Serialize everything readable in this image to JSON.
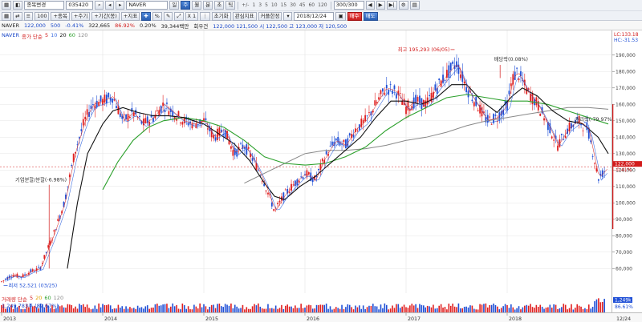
{
  "toolbar": {
    "menu_label": "종목변경",
    "code": "035420",
    "name": "NAVER",
    "period_tabs": [
      "일",
      "주",
      "월",
      "분",
      "초",
      "틱"
    ],
    "active_period": "주",
    "nav_minus": "+/-",
    "nav_numbers": [
      "1",
      "3",
      "5",
      "10",
      "15",
      "30",
      "45",
      "60",
      "120"
    ],
    "count_value": "300",
    "count_total": "/300",
    "row2_items": [
      "종목",
      "주기",
      "기간(봉)",
      "지표"
    ],
    "mult_label": "X 1",
    "init_button": "초기화",
    "interest_button": "관심지표",
    "custom_button": "커플한정",
    "date_value": "2018/12/24",
    "buy_button": "매수",
    "sell_button": "매도"
  },
  "infobar": {
    "name": "NAVER",
    "price": "122,000",
    "change": "500",
    "change_pct": "-0.41%",
    "volume": "322,665",
    "ratio": "86.92%",
    "turnover": "0.20%",
    "amount": "39,344백만",
    "turnover_label": "회우건",
    "ohlc_label": "122,000 121,500 시 122,500 고 123,000 저 120,500"
  },
  "price_legend": {
    "name": "NAVER",
    "label": "종가 단순",
    "periods": [
      "5",
      "10",
      "20",
      "60",
      "120"
    ],
    "colors": [
      "#d21b1b",
      "#3f6fe0",
      "#111111",
      "#2ca02c",
      "#888888"
    ]
  },
  "volume_legend": {
    "label": "거래량 단순",
    "periods": [
      "5",
      "20",
      "60",
      "120"
    ],
    "colors": [
      "#d21b1b",
      "#e0a000",
      "#2ca02c",
      "#888888"
    ],
    "sub": "1,249,783주 (89.67%)"
  },
  "right_panel": {
    "lc": "LC:133.18",
    "hc": "HC:-31.53",
    "last_price_tag": "122,000",
    "last_change_tag": "-0.41%",
    "volume_tag": "1,249k",
    "volume_pct_tag": "86.61%"
  },
  "annotations": {
    "high": "최고 195,293 (06/05)",
    "low": "최저 52,521 (03/25)",
    "split": "기업분할/분할(-6.98%)",
    "dividend": "배당락(0.08%)",
    "right_note": "권리락(-79.97%)"
  },
  "chart_data": {
    "type": "candlestick",
    "frequency": "weekly",
    "y_ticks": [
      60000,
      70000,
      80000,
      90000,
      100000,
      110000,
      120000,
      130000,
      140000,
      150000,
      160000,
      170000,
      180000,
      190000
    ],
    "ylim": [
      45000,
      205000
    ],
    "x_labels": [
      "2013",
      "2014",
      "2015",
      "2016",
      "2017",
      "2018",
      "12/24"
    ],
    "close_path": [
      [
        2013.0,
        52000
      ],
      [
        2013.1,
        56000
      ],
      [
        2013.2,
        55000
      ],
      [
        2013.28,
        58000
      ],
      [
        2013.38,
        60000
      ],
      [
        2013.52,
        82000
      ],
      [
        2013.62,
        100000
      ],
      [
        2013.72,
        130000
      ],
      [
        2013.82,
        150000
      ],
      [
        2013.9,
        160000
      ],
      [
        2014.0,
        162000
      ],
      [
        2014.1,
        165000
      ],
      [
        2014.2,
        150000
      ],
      [
        2014.3,
        155000
      ],
      [
        2014.4,
        148000
      ],
      [
        2014.5,
        152000
      ],
      [
        2014.6,
        160000
      ],
      [
        2014.7,
        155000
      ],
      [
        2014.8,
        150000
      ],
      [
        2014.9,
        148000
      ],
      [
        2015.0,
        150000
      ],
      [
        2015.1,
        140000
      ],
      [
        2015.2,
        145000
      ],
      [
        2015.3,
        130000
      ],
      [
        2015.4,
        135000
      ],
      [
        2015.5,
        125000
      ],
      [
        2015.6,
        112000
      ],
      [
        2015.7,
        95000
      ],
      [
        2015.8,
        105000
      ],
      [
        2015.9,
        112000
      ],
      [
        2016.0,
        118000
      ],
      [
        2016.1,
        114000
      ],
      [
        2016.2,
        128000
      ],
      [
        2016.3,
        138000
      ],
      [
        2016.4,
        135000
      ],
      [
        2016.5,
        145000
      ],
      [
        2016.6,
        150000
      ],
      [
        2016.7,
        160000
      ],
      [
        2016.8,
        170000
      ],
      [
        2016.9,
        168000
      ],
      [
        2017.0,
        158000
      ],
      [
        2017.1,
        162000
      ],
      [
        2017.2,
        160000
      ],
      [
        2017.3,
        170000
      ],
      [
        2017.4,
        178000
      ],
      [
        2017.5,
        185000
      ],
      [
        2017.6,
        170000
      ],
      [
        2017.7,
        160000
      ],
      [
        2017.8,
        150000
      ],
      [
        2017.9,
        152000
      ],
      [
        2018.0,
        160000
      ],
      [
        2018.05,
        175000
      ],
      [
        2018.1,
        180000
      ],
      [
        2018.2,
        168000
      ],
      [
        2018.3,
        160000
      ],
      [
        2018.4,
        148000
      ],
      [
        2018.5,
        135000
      ],
      [
        2018.6,
        145000
      ],
      [
        2018.7,
        150000
      ],
      [
        2018.8,
        145000
      ],
      [
        2018.9,
        115000
      ],
      [
        2019.0,
        122000
      ]
    ],
    "series": [
      {
        "name": "5",
        "color": "#d21b1b"
      },
      {
        "name": "10",
        "color": "#3f6fe0"
      },
      {
        "name": "20",
        "color": "#111111"
      },
      {
        "name": "60",
        "color": "#2ca02c"
      },
      {
        "name": "120",
        "color": "#888888"
      }
    ],
    "ma20": [
      [
        2013.65,
        60000
      ],
      [
        2013.75,
        100000
      ],
      [
        2013.85,
        130000
      ],
      [
        2014.0,
        148000
      ],
      [
        2014.1,
        156000
      ],
      [
        2014.2,
        158000
      ],
      [
        2014.35,
        155000
      ],
      [
        2014.5,
        153000
      ],
      [
        2014.65,
        153000
      ],
      [
        2014.8,
        152000
      ],
      [
        2015.0,
        148000
      ],
      [
        2015.15,
        142000
      ],
      [
        2015.3,
        136000
      ],
      [
        2015.45,
        126000
      ],
      [
        2015.6,
        112000
      ],
      [
        2015.7,
        104000
      ],
      [
        2015.8,
        102000
      ],
      [
        2015.95,
        110000
      ],
      [
        2016.1,
        116000
      ],
      [
        2016.25,
        124000
      ],
      [
        2016.4,
        132000
      ],
      [
        2016.55,
        140000
      ],
      [
        2016.7,
        152000
      ],
      [
        2016.85,
        162000
      ],
      [
        2017.0,
        162000
      ],
      [
        2017.15,
        160000
      ],
      [
        2017.3,
        164000
      ],
      [
        2017.45,
        172000
      ],
      [
        2017.6,
        172000
      ],
      [
        2017.75,
        162000
      ],
      [
        2017.9,
        155000
      ],
      [
        2018.05,
        165000
      ],
      [
        2018.15,
        170000
      ],
      [
        2018.3,
        165000
      ],
      [
        2018.45,
        156000
      ],
      [
        2018.6,
        150000
      ],
      [
        2018.75,
        148000
      ],
      [
        2018.9,
        140000
      ],
      [
        2019.0,
        130000
      ]
    ],
    "ma60": [
      [
        2014.0,
        108000
      ],
      [
        2014.15,
        125000
      ],
      [
        2014.3,
        138000
      ],
      [
        2014.45,
        146000
      ],
      [
        2014.6,
        150000
      ],
      [
        2014.8,
        152000
      ],
      [
        2015.0,
        150000
      ],
      [
        2015.2,
        146000
      ],
      [
        2015.4,
        138000
      ],
      [
        2015.6,
        128000
      ],
      [
        2015.8,
        124000
      ],
      [
        2016.0,
        123000
      ],
      [
        2016.2,
        124000
      ],
      [
        2016.4,
        128000
      ],
      [
        2016.6,
        134000
      ],
      [
        2016.8,
        144000
      ],
      [
        2017.0,
        152000
      ],
      [
        2017.2,
        158000
      ],
      [
        2017.4,
        164000
      ],
      [
        2017.6,
        166000
      ],
      [
        2017.8,
        164000
      ],
      [
        2018.0,
        162000
      ],
      [
        2018.2,
        162000
      ],
      [
        2018.4,
        160000
      ],
      [
        2018.6,
        156000
      ],
      [
        2018.8,
        152000
      ],
      [
        2019.0,
        148000
      ]
    ],
    "ma120": [
      [
        2015.4,
        112000
      ],
      [
        2015.6,
        118000
      ],
      [
        2015.8,
        124000
      ],
      [
        2016.0,
        130000
      ],
      [
        2016.2,
        132000
      ],
      [
        2016.4,
        132000
      ],
      [
        2016.6,
        133000
      ],
      [
        2016.8,
        135000
      ],
      [
        2017.0,
        138000
      ],
      [
        2017.2,
        140000
      ],
      [
        2017.4,
        143000
      ],
      [
        2017.6,
        147000
      ],
      [
        2017.8,
        150000
      ],
      [
        2018.0,
        152000
      ],
      [
        2018.2,
        154000
      ],
      [
        2018.4,
        156000
      ],
      [
        2018.6,
        158000
      ],
      [
        2018.8,
        158000
      ],
      [
        2019.0,
        157000
      ]
    ],
    "last_close": 122000
  }
}
